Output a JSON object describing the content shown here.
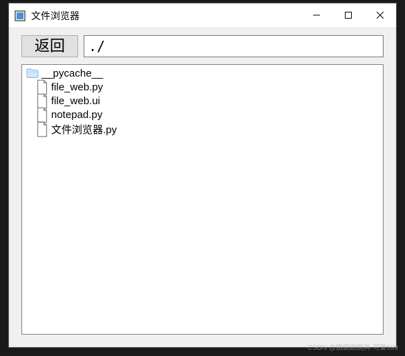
{
  "window": {
    "title": "文件浏览器"
  },
  "toolbar": {
    "back_label": "返回",
    "path_value": "./"
  },
  "files": [
    {
      "name": "__pycache__",
      "type": "folder",
      "indent": false
    },
    {
      "name": "file_web.py",
      "type": "file",
      "indent": true
    },
    {
      "name": "file_web.ui",
      "type": "file",
      "indent": true
    },
    {
      "name": "notepad.py",
      "type": "file",
      "indent": true
    },
    {
      "name": "文件浏览器.py",
      "type": "file",
      "indent": true
    }
  ],
  "watermark": "CSDN @跳跳跳跳兵·可爱599"
}
